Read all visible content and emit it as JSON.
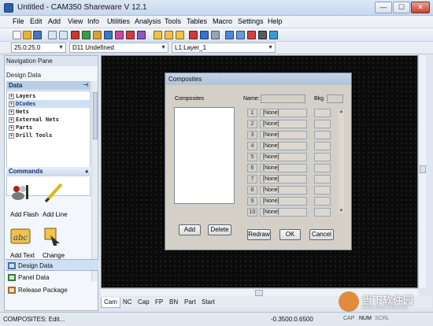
{
  "window": {
    "title": "Untitled - CAM350 Shareware V 12.1",
    "minimize": "—",
    "maximize": "☐",
    "close": "✕"
  },
  "menu": [
    "File",
    "Edit",
    "Add",
    "View",
    "Info",
    "Utilities",
    "Analysis",
    "Tools",
    "Tables",
    "Macro",
    "Settings",
    "Help"
  ],
  "toolbar2": {
    "grid_value": "25.0:25.0",
    "dcode_value": "D11  Undefined",
    "layer_value": "L1:Layer_1"
  },
  "nav": {
    "title": "Navigation Pane",
    "section": "Design Data",
    "data_header": "Data",
    "tree": [
      "Layers",
      "DCodes",
      "Nets",
      "External Nets",
      "Parts",
      "Drill Tools"
    ],
    "selected_index": 1,
    "commands_header": "Commands",
    "commands": [
      "Add Flash",
      "Add Line",
      "Add Text",
      "Change"
    ],
    "buttons": [
      "Design Data",
      "Panel Data",
      "Release Package"
    ],
    "active_button": "Design Data"
  },
  "tabs": [
    "Cam",
    "NC",
    "Cap",
    "FP",
    "BN",
    "Part",
    "Start"
  ],
  "active_tab": "Cam",
  "status": {
    "left": "COMPOSITES: Edit...",
    "coords": "-0.3500:0.6500",
    "keys": [
      "CAP",
      "NUM",
      "SCRL"
    ]
  },
  "dialog": {
    "title": "Composites",
    "composites_label": "Composites",
    "name_label": "Name:",
    "bkg_label": "Bkg",
    "layers": [
      {
        "num": "1",
        "name": "[None]"
      },
      {
        "num": "2",
        "name": "[None]"
      },
      {
        "num": "3",
        "name": "[None]"
      },
      {
        "num": "4",
        "name": "[None]"
      },
      {
        "num": "5",
        "name": "[None]"
      },
      {
        "num": "6",
        "name": "[None]"
      },
      {
        "num": "7",
        "name": "[None]"
      },
      {
        "num": "8",
        "name": "[None]"
      },
      {
        "num": "9",
        "name": "[None]"
      },
      {
        "num": "10",
        "name": "[None]"
      }
    ],
    "add_button": "Add",
    "delete_button": "Delete",
    "redraw_button": "Redraw",
    "ok_button": "OK",
    "cancel_button": "Cancel"
  },
  "watermark": {
    "text": "当下软件园",
    "sub": "www.downxia.com"
  }
}
